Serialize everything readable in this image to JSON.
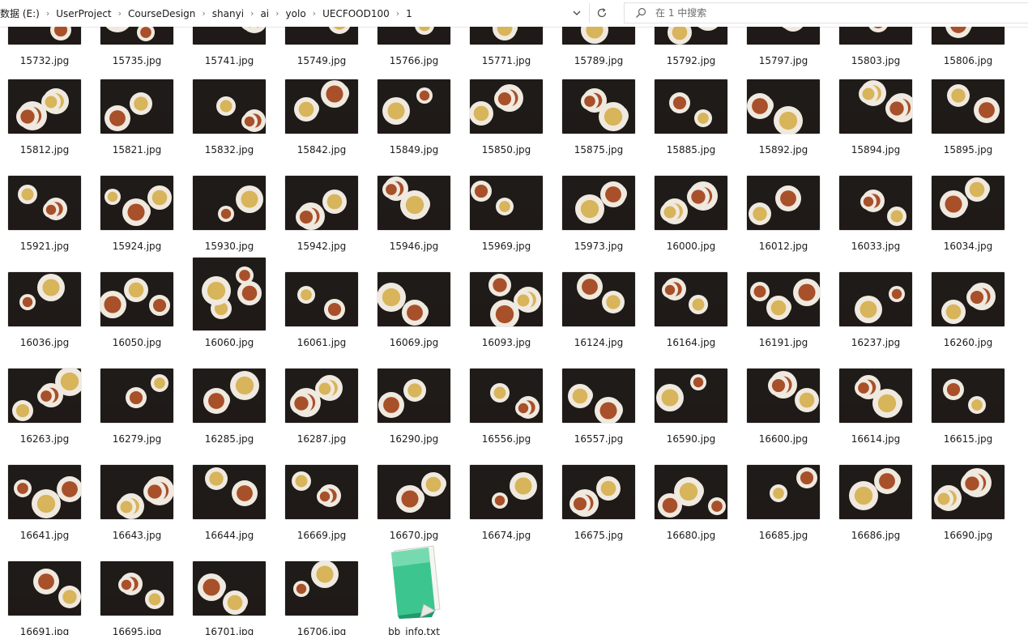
{
  "address_bar": {
    "crumbs": [
      "数据 (E:)",
      "UserProject",
      "CourseDesign",
      "shanyi",
      "ai",
      "yolo",
      "UECFOOD100",
      "1"
    ]
  },
  "search": {
    "placeholder": "在 1 中搜索"
  },
  "icons": {
    "dropdown": "chevron-down-icon",
    "refresh": "refresh-icon",
    "search": "search-icon"
  },
  "rows": [
    [
      "15732.jpg",
      "15735.jpg",
      "15741.jpg",
      "15749.jpg",
      "15766.jpg",
      "15771.jpg",
      "15789.jpg",
      "15792.jpg",
      "15797.jpg",
      "15803.jpg",
      "15806.jpg"
    ],
    [
      "15812.jpg",
      "15821.jpg",
      "15832.jpg",
      "15842.jpg",
      "15849.jpg",
      "15850.jpg",
      "15875.jpg",
      "15885.jpg",
      "15892.jpg",
      "15894.jpg",
      "15895.jpg"
    ],
    [
      "15921.jpg",
      "15924.jpg",
      "15930.jpg",
      "15942.jpg",
      "15946.jpg",
      "15969.jpg",
      "15973.jpg",
      "16000.jpg",
      "16012.jpg",
      "16033.jpg",
      "16034.jpg"
    ],
    [
      "16036.jpg",
      "16050.jpg",
      "16060.jpg",
      "16061.jpg",
      "16069.jpg",
      "16093.jpg",
      "16124.jpg",
      "16164.jpg",
      "16191.jpg",
      "16237.jpg",
      "16260.jpg"
    ],
    [
      "16263.jpg",
      "16279.jpg",
      "16285.jpg",
      "16287.jpg",
      "16290.jpg",
      "16556.jpg",
      "16557.jpg",
      "16590.jpg",
      "16600.jpg",
      "16614.jpg",
      "16615.jpg"
    ],
    [
      "16641.jpg",
      "16643.jpg",
      "16644.jpg",
      "16669.jpg",
      "16670.jpg",
      "16674.jpg",
      "16675.jpg",
      "16680.jpg",
      "16685.jpg",
      "16686.jpg",
      "16690.jpg"
    ],
    [
      "16691.jpg",
      "16695.jpg",
      "16701.jpg",
      "16706.jpg",
      "bb_info.txt"
    ]
  ],
  "text_file": {
    "name": "bb_info.txt",
    "icon": "text-document-icon"
  },
  "colors": {
    "txt_icon_green": "#3cc58f",
    "txt_icon_dark": "#1e9a6b"
  }
}
